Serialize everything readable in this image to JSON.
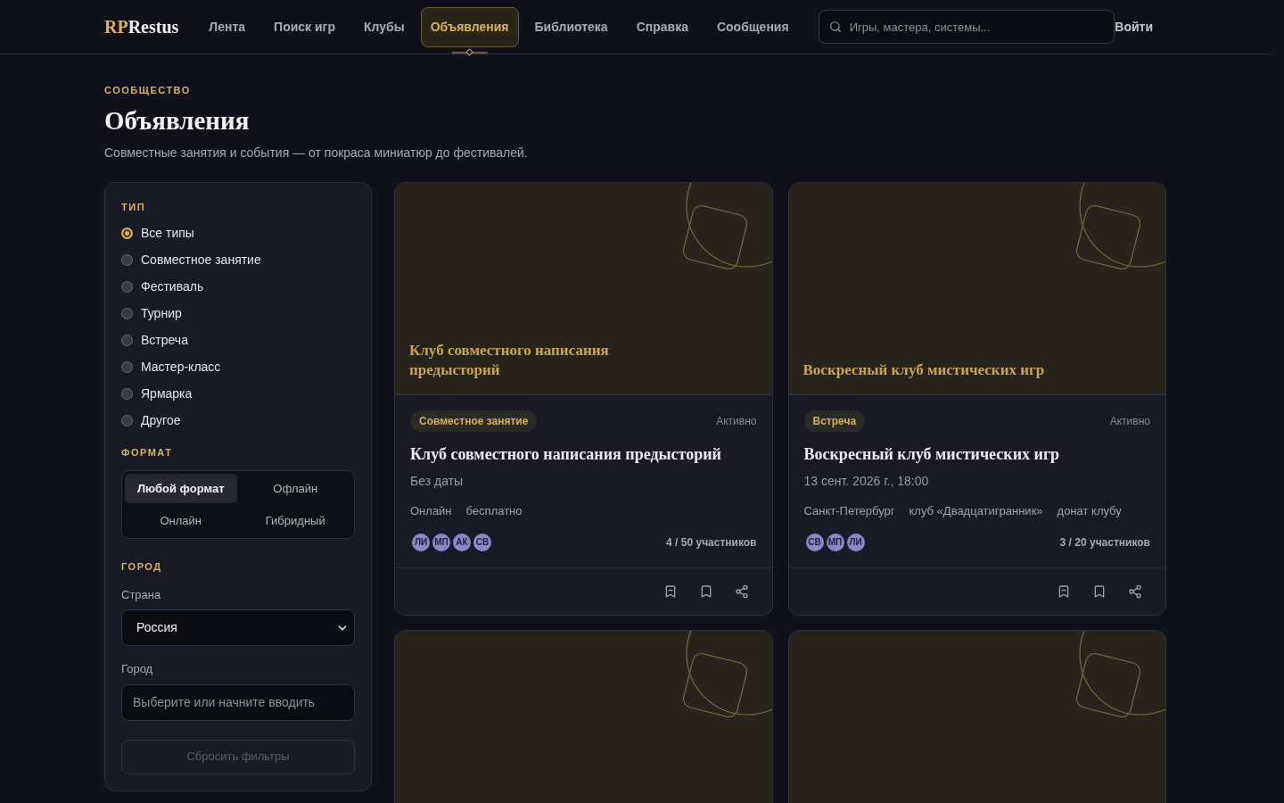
{
  "header": {
    "logo": {
      "accent": "RP",
      "rest": "Restus"
    },
    "nav": [
      {
        "label": "Лента",
        "selected": false
      },
      {
        "label": "Поиск игр",
        "selected": false
      },
      {
        "label": "Клубы",
        "selected": false
      },
      {
        "label": "Объявления",
        "selected": true
      },
      {
        "label": "Библиотека",
        "selected": false
      },
      {
        "label": "Справка",
        "selected": false
      },
      {
        "label": "Сообщения",
        "selected": false
      }
    ],
    "search": {
      "placeholder": "Игры, мастера, системы..."
    },
    "login": "Войти"
  },
  "intro": {
    "eyebrow": "СООБЩЕСТВО",
    "title": "Объявления",
    "subtitle": "Совместные занятия и события — от покраса миниатюр до фестивалей."
  },
  "filters": {
    "type": {
      "heading": "ТИП",
      "options": [
        {
          "label": "Все типы",
          "selected": true
        },
        {
          "label": "Совместное занятие",
          "selected": false
        },
        {
          "label": "Фестиваль",
          "selected": false
        },
        {
          "label": "Турнир",
          "selected": false
        },
        {
          "label": "Встреча",
          "selected": false
        },
        {
          "label": "Мастер-класс",
          "selected": false
        },
        {
          "label": "Ярмарка",
          "selected": false
        },
        {
          "label": "Другое",
          "selected": false
        }
      ]
    },
    "format": {
      "heading": "ФОРМАТ",
      "options": [
        {
          "label": "Любой формат",
          "selected": true
        },
        {
          "label": "Офлайн",
          "selected": false
        },
        {
          "label": "Онлайн",
          "selected": false
        },
        {
          "label": "Гибридный",
          "selected": false
        }
      ]
    },
    "city": {
      "heading": "ГОРОД",
      "country_label": "Страна",
      "country_value": "Россия",
      "city_label": "Город",
      "city_placeholder": "Выберите или начните вводить"
    },
    "reset": {
      "label": "Сбросить фильтры",
      "disabled": true
    }
  },
  "cards": [
    {
      "kind": "full",
      "cover_title": "Клуб совместного написания предысторий",
      "type_badge": "Совместное занятие",
      "status": "Активно",
      "title": "Клуб совместного написания предысторий",
      "date": "Без даты",
      "tags": [
        "Онлайн",
        "бесплатно"
      ],
      "avatars": [
        "ЛИ",
        "МП",
        "АК",
        "СВ"
      ],
      "participants": "4 / 50 участников"
    },
    {
      "kind": "full",
      "cover_title": "Воскресный клуб мистических игр",
      "type_badge": "Встреча",
      "status": "Активно",
      "title": "Воскресный клуб мистических игр",
      "date": "13 сент. 2026 г., 18:00",
      "tags": [
        "Санкт-Петербург",
        "клуб «Двадцатигранник»",
        "донат клубу"
      ],
      "avatars": [
        "СВ",
        "МП",
        "ЛИ"
      ],
      "participants": "3 / 20 участников"
    },
    {
      "kind": "cover"
    },
    {
      "kind": "cover"
    }
  ]
}
